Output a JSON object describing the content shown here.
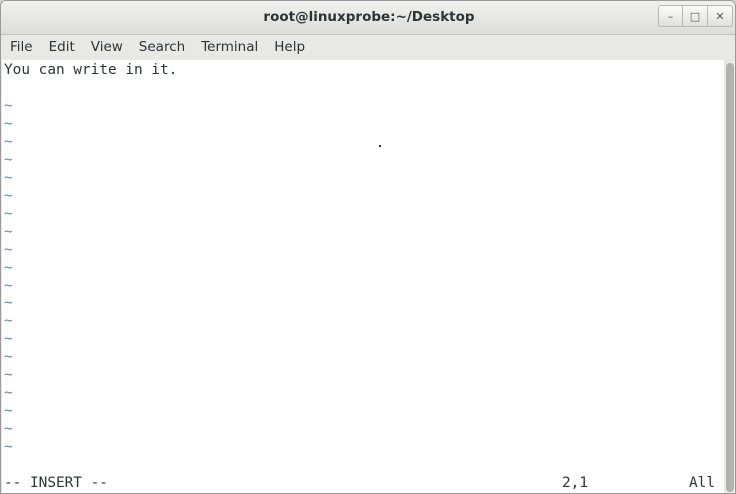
{
  "window": {
    "title": "root@linuxprobe:~/Desktop",
    "minimize_glyph": "–",
    "maximize_glyph": "□",
    "close_glyph": "✕"
  },
  "menubar": {
    "items": [
      "File",
      "Edit",
      "View",
      "Search",
      "Terminal",
      "Help"
    ]
  },
  "editor": {
    "lines": [
      "You can write in it.",
      ""
    ],
    "empty_line_marker": "~",
    "empty_line_count": 20
  },
  "statusline": {
    "mode": "-- INSERT --",
    "position": "2,1",
    "scroll": "All"
  },
  "scrollbar": {
    "visible_fraction": 1.0
  },
  "colors": {
    "tilde": "#5c8ab8",
    "text": "#2e3436",
    "background": "#ffffff"
  }
}
